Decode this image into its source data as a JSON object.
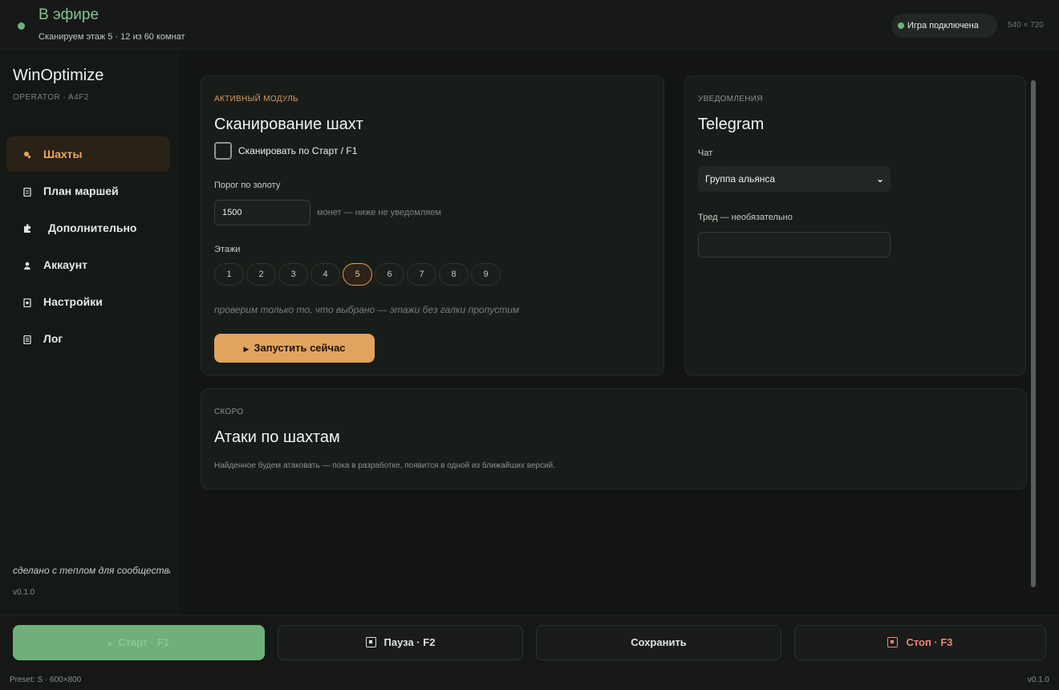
{
  "top": {
    "status_title": "В эфире",
    "status_sub": "Сканируем этаж 5 · 12 из 60 комнат",
    "game_status": "Игра подключена",
    "dimensions": "540 × 720"
  },
  "sidebar": {
    "brand": "WinOptimize",
    "operator": "OPERATOR · A4F2",
    "items": [
      {
        "label": "Шахты",
        "icon": "pickaxe-icon",
        "active": true
      },
      {
        "label": "План маршей",
        "icon": "document-icon"
      },
      {
        "label": "Дополнительно",
        "icon": "puzzle-icon"
      },
      {
        "label": "Аккаунт",
        "icon": "user-icon"
      },
      {
        "label": "Настройки",
        "icon": "settings-icon"
      },
      {
        "label": "Лог",
        "icon": "log-icon"
      }
    ],
    "footer_note": "сделано с теплом для сообщества",
    "version": "v0.1.0"
  },
  "module": {
    "eyebrow": "АКТИВНЫЙ МОДУЛЬ",
    "title": "Сканирование шахт",
    "checkbox_label": "Сканировать по Старт / F1",
    "checkbox_checked": false,
    "threshold_label": "Порог по золоту",
    "threshold_value": "1500",
    "threshold_hint": "монет — ниже не уведомляем",
    "floors_label": "Этажи",
    "floors": [
      "1",
      "2",
      "3",
      "4",
      "5",
      "6",
      "7",
      "8",
      "9"
    ],
    "selected_floor": "5",
    "floors_note": "проверим только то, что выбрано — этажи без галки пропустим",
    "run_label": "Запустить сейчас"
  },
  "notifications": {
    "eyebrow": "УВЕДОМЛЕНИЯ",
    "title": "Telegram",
    "chat_label": "Чат",
    "chat_value": "Группа альянса",
    "thread_label": "Тред — необязательно",
    "thread_value": ""
  },
  "soon": {
    "eyebrow": "СКОРО",
    "title": "Атаки по шахтам",
    "text": "Найденное будем атаковать — пока в разработке, появится в одной из ближайших версий."
  },
  "bottom": {
    "start_label": "Старт · F1",
    "pause_label": "Пауза · F2",
    "save_label": "Сохранить",
    "stop_label": "Стоп · F3",
    "preset": "Preset: S · 600×800",
    "version": "v0.1.0"
  },
  "colors": {
    "accent": "#e2a35e",
    "live_green": "#6fb07a",
    "stop_red": "#ec8677",
    "background": "#121513"
  }
}
